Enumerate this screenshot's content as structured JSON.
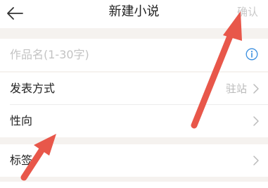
{
  "header": {
    "title": "新建小说",
    "confirm_label": "确认",
    "back_icon": "arrow-left-icon"
  },
  "form": {
    "title_placeholder": "作品名(1-30字)",
    "publish_method": {
      "label": "发表方式",
      "value": "驻站"
    },
    "orientation": {
      "label": "性向"
    },
    "tags": {
      "label": "标签"
    }
  },
  "colors": {
    "background": "#f5f2ef",
    "annotation_arrow": "#e8574a",
    "info_icon": "#3a8fe0",
    "confirm_disabled": "#c9c9c9"
  }
}
